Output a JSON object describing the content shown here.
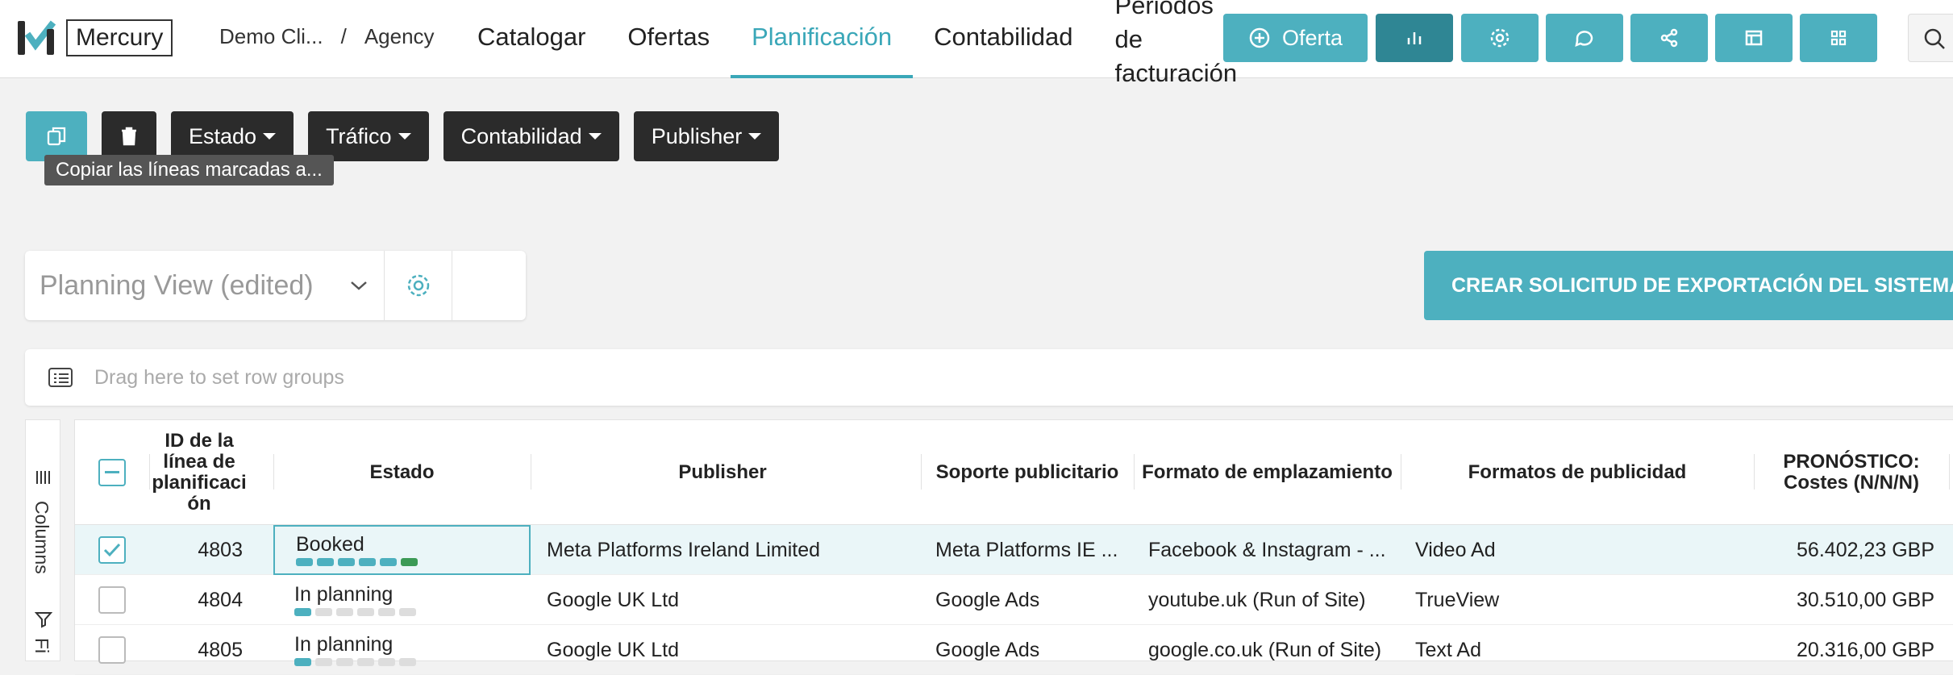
{
  "app": {
    "name": "Mercury"
  },
  "breadcrumb": {
    "client": "Demo Cli...",
    "separator": "/",
    "agency": "Agency"
  },
  "nav": {
    "items": [
      "Catalogar",
      "Ofertas",
      "Planificación",
      "Contabilidad"
    ],
    "billing": [
      "Periodos",
      "de",
      "facturación"
    ],
    "active": "Planificación"
  },
  "toolbar": {
    "offer_label": "Oferta"
  },
  "actions": {
    "estado": "Estado",
    "trafico": "Tráfico",
    "contabilidad": "Contabilidad",
    "publisher": "Publisher",
    "tooltip": "Copiar las líneas marcadas a..."
  },
  "view": {
    "selected": "Planning View (edited)"
  },
  "export": {
    "label": "CREAR SOLICITUD DE EXPORTACIÓN DEL SISTEMA DE CONTABILIDAD"
  },
  "groupbar": {
    "placeholder": "Drag here to set row groups"
  },
  "sidepanel": {
    "columns_label": "Columns",
    "filters_label": "Fi"
  },
  "table": {
    "headers": {
      "id": [
        "ID de la",
        "línea de",
        "planificaci",
        "ón"
      ],
      "estado": "Estado",
      "publisher": "Publisher",
      "soporte": "Soporte publicitario",
      "formato_emplazamiento": "Formato de emplazamiento",
      "formatos_publicidad": "Formatos de publicidad",
      "pronostico": [
        "PRONÓSTICO:",
        "Costes (N/N/N)"
      ]
    },
    "rows": [
      {
        "id": "4803",
        "estado": "Booked",
        "progress_filled": 6,
        "publisher": "Meta Platforms Ireland Limited",
        "soporte": "Meta Platforms IE ...",
        "formato_emplazamiento": "Facebook & Instagram - ...",
        "formatos_publicidad": "Video Ad",
        "pronostico": "56.402,23 GBP",
        "selected": true
      },
      {
        "id": "4804",
        "estado": "In planning",
        "progress_filled": 1,
        "publisher": "Google UK Ltd",
        "soporte": "Google Ads",
        "formato_emplazamiento": "youtube.uk (Run of Site)",
        "formatos_publicidad": "TrueView",
        "pronostico": "30.510,00 GBP",
        "selected": false
      },
      {
        "id": "4805",
        "estado": "In planning",
        "progress_filled": 1,
        "publisher": "Google UK Ltd",
        "soporte": "Google Ads",
        "formato_emplazamiento": "google.co.uk (Run of Site)",
        "formatos_publicidad": "Text Ad",
        "pronostico": "20.316,00 GBP",
        "selected": false
      }
    ]
  },
  "colors": {
    "accent": "#4db0bf",
    "accent_dark": "#2f8694",
    "dark_button": "#2b2b2b",
    "booked_green": "#3c9a56"
  }
}
